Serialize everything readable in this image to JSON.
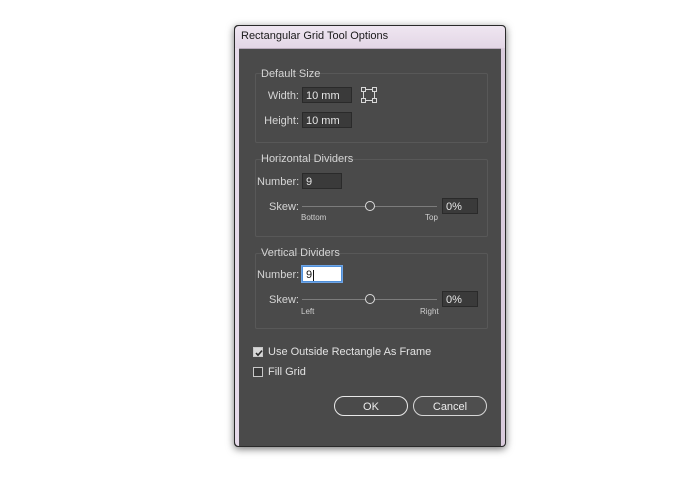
{
  "dialog": {
    "title": "Rectangular Grid Tool Options"
  },
  "default_size": {
    "group_title": "Default Size",
    "width_label": "Width:",
    "width_value": "10 mm",
    "height_label": "Height:",
    "height_value": "10 mm",
    "reference_icon": "reference-point-square-icon"
  },
  "horizontal_dividers": {
    "group_title": "Horizontal Dividers",
    "number_label": "Number:",
    "number_value": "9",
    "skew_label": "Skew:",
    "skew_value": "0%",
    "skew_min_label": "Bottom",
    "skew_max_label": "Top",
    "skew_position": 0.5
  },
  "vertical_dividers": {
    "group_title": "Vertical Dividers",
    "number_label": "Number:",
    "number_value": "9",
    "skew_label": "Skew:",
    "skew_value": "0%",
    "skew_min_label": "Left",
    "skew_max_label": "Right",
    "skew_position": 0.5
  },
  "options": {
    "use_outside_rect_label": "Use Outside Rectangle As Frame",
    "use_outside_rect_checked": true,
    "fill_grid_label": "Fill Grid",
    "fill_grid_checked": false
  },
  "buttons": {
    "ok": "OK",
    "cancel": "Cancel"
  }
}
